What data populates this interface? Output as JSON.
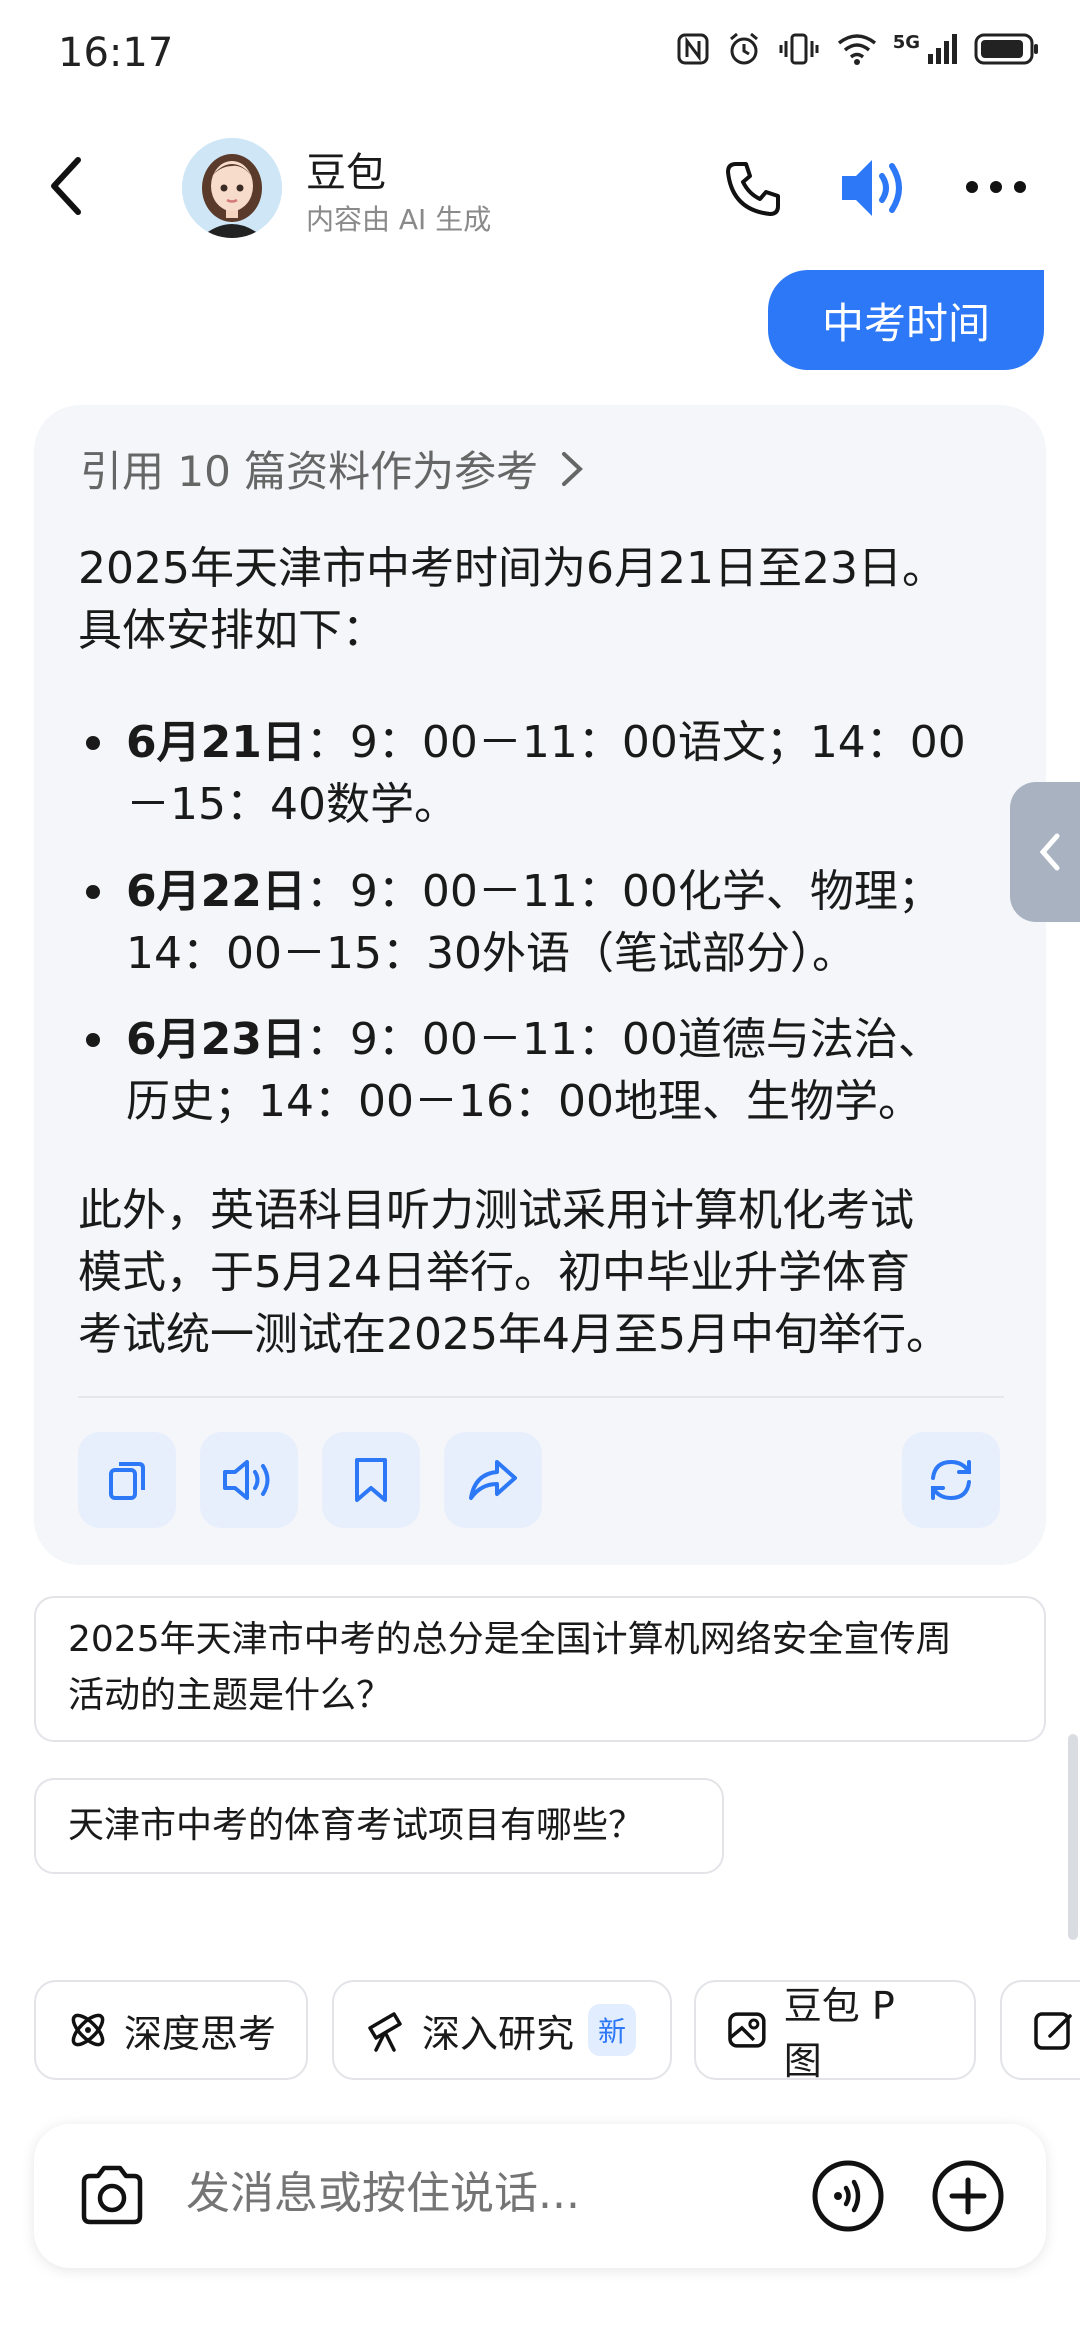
{
  "status_bar": {
    "time": "16:17",
    "network": "5G"
  },
  "header": {
    "title": "豆包",
    "subtitle": "内容由 AI 生成"
  },
  "user_message": "中考时间",
  "answer": {
    "reference": "引用 10 篇资料作为参考",
    "intro_1": "2025年天津市中考时间为6月21日至23日。",
    "intro_2": "具体安排如下：",
    "items": [
      {
        "date": "6月21日",
        "line1": "：9：00－11：00语文；14：00",
        "line2": "－15：40数学。"
      },
      {
        "date": "6月22日",
        "line1": "：9：00－11：00化学、物理；",
        "line2": "14：00－15：30外语（笔试部分）。"
      },
      {
        "date": "6月23日",
        "line1": "：9：00－11：00道德与法治、",
        "line2": "历史；14：00－16：00地理、生物学。"
      }
    ],
    "outro_1": "此外，英语科目听力测试采用计算机化考试",
    "outro_2": "模式，于5月24日举行。初中毕业升学体育",
    "outro_3": "考试统一测试在2025年4月至5月中旬举行。"
  },
  "suggestions": [
    {
      "line1": "2025年天津市中考的总分是全国计算机网络安全宣传周",
      "line2": "活动的主题是什么？"
    },
    {
      "line1": "天津市中考的体育考试项目有哪些？"
    }
  ],
  "tools": [
    {
      "label": "深度思考"
    },
    {
      "label": "深入研究",
      "badge": "新"
    },
    {
      "label": "豆包 P 图"
    }
  ],
  "input": {
    "placeholder": "发消息或按住说话..."
  },
  "colors": {
    "accent": "#2c78f6",
    "card_bg": "#f4f6f9"
  }
}
